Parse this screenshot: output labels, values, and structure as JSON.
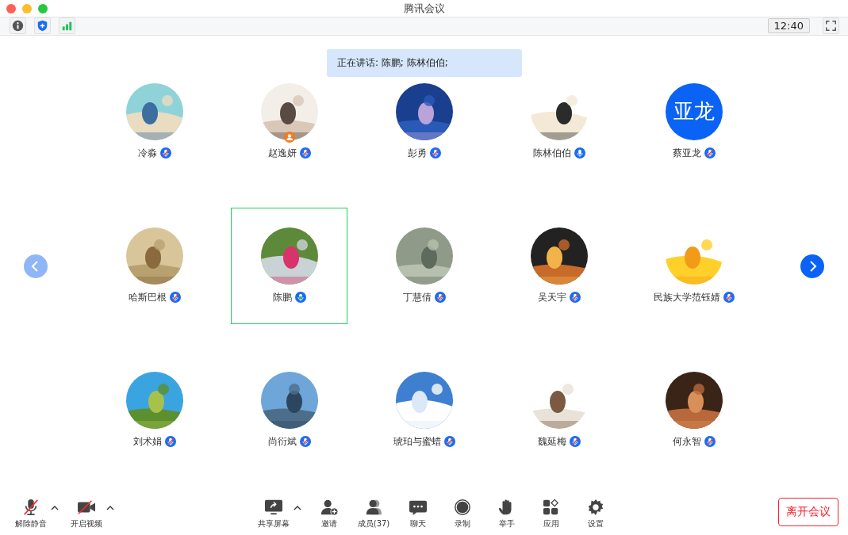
{
  "window": {
    "title": "腾讯会议"
  },
  "toolbar": {
    "time": "12:40"
  },
  "speaking_banner": "正在讲话: 陈鹏; 陈林伯伯;",
  "participants": [
    {
      "name": "冷淼",
      "muted": true,
      "speaking": false,
      "host": false,
      "selected": false
    },
    {
      "name": "赵逸妍",
      "muted": true,
      "speaking": false,
      "host": true,
      "selected": false
    },
    {
      "name": "彭勇",
      "muted": true,
      "speaking": false,
      "host": false,
      "selected": false
    },
    {
      "name": "陈林伯伯",
      "muted": false,
      "speaking": false,
      "host": false,
      "selected": false
    },
    {
      "name": "蔡亚龙",
      "avatar": {
        "kind": "text",
        "text": "亚龙"
      },
      "muted": true,
      "speaking": false,
      "host": false,
      "selected": false
    },
    {
      "name": "哈斯巴根",
      "muted": true,
      "speaking": false,
      "host": false,
      "selected": false
    },
    {
      "name": "陈鹏",
      "muted": false,
      "speaking": true,
      "host": false,
      "selected": true
    },
    {
      "name": "丁慧倩",
      "muted": true,
      "speaking": false,
      "host": false,
      "selected": false
    },
    {
      "name": "吴天宇",
      "muted": true,
      "speaking": false,
      "host": false,
      "selected": false
    },
    {
      "name": "民族大学范钰婧",
      "muted": true,
      "speaking": false,
      "host": false,
      "selected": false
    },
    {
      "name": "刘术娟",
      "muted": true,
      "speaking": false,
      "host": false,
      "selected": false
    },
    {
      "name": "尚衍斌",
      "muted": true,
      "speaking": false,
      "host": false,
      "selected": false
    },
    {
      "name": "琥珀与蜜蜡",
      "muted": true,
      "speaking": false,
      "host": false,
      "selected": false
    },
    {
      "name": "魏延梅",
      "muted": true,
      "speaking": false,
      "host": false,
      "selected": false
    },
    {
      "name": "何永智",
      "muted": true,
      "speaking": false,
      "host": false,
      "selected": false
    }
  ],
  "pager": {
    "prev_disabled": true,
    "next_disabled": false
  },
  "controls_left": [
    {
      "kind": "mic",
      "label": "解除静音",
      "off": true,
      "menu": true
    },
    {
      "kind": "video",
      "label": "开启视频",
      "off": true,
      "menu": true
    }
  ],
  "controls_center": [
    {
      "kind": "share",
      "label": "共享屏幕",
      "menu": true
    },
    {
      "kind": "invite",
      "label": "邀请",
      "menu": false
    },
    {
      "kind": "members",
      "label": "成员(37)",
      "menu": false
    },
    {
      "kind": "chat",
      "label": "聊天",
      "menu": false
    },
    {
      "kind": "record",
      "label": "录制",
      "menu": false
    },
    {
      "kind": "hand",
      "label": "举手",
      "menu": false
    },
    {
      "kind": "apps",
      "label": "应用",
      "menu": false
    },
    {
      "kind": "settings",
      "label": "设置",
      "menu": false
    }
  ],
  "leave_button": "离开会议"
}
